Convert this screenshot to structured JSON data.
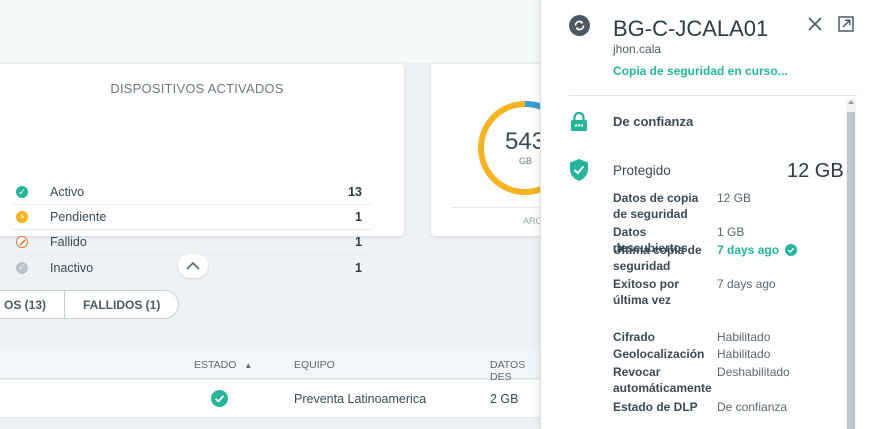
{
  "devices_card": {
    "title": "DISPOSITIVOS ACTIVADOS",
    "rows": [
      {
        "label": "Activo",
        "count": "13",
        "color": "#26b49a",
        "icon": "check-circle-icon"
      },
      {
        "label": "Pendiente",
        "count": "1",
        "color": "#f3b322",
        "icon": "clock-icon"
      },
      {
        "label": "Fallido",
        "count": "1",
        "color": "#e0773a",
        "icon": "prohibited-icon"
      },
      {
        "label": "Inactivo",
        "count": "1",
        "color": "#b8c1c7",
        "icon": "check-circle-icon"
      }
    ]
  },
  "storage_card": {
    "value": "543",
    "unit": "GB",
    "footer_label": "ARC",
    "ring_colors": {
      "main": "#f3b322",
      "accent": "#3aa0d8"
    }
  },
  "filters": {
    "tabs": [
      {
        "label": "OS (13)"
      },
      {
        "label": "FALLIDOS (1)"
      }
    ]
  },
  "table": {
    "headers": {
      "estado": "ESTADO",
      "sort_indicator": "▲",
      "equipo": "EQUIPO",
      "datos": "DATOS DES"
    },
    "rows": [
      {
        "status_icon": "check-circle-icon",
        "equipo": "Preventa Latinoamerica",
        "datos": "2 GB"
      }
    ]
  },
  "panel": {
    "title": "BG-C-JCALA01",
    "user": "jhon.cala",
    "status": "Copia de seguridad en curso...",
    "trust_label": "De confianza",
    "protect_label": "Protegido",
    "protect_size": "12 GB",
    "details": [
      {
        "key": "Datos de copia de seguridad",
        "value": "12 GB"
      },
      {
        "key": "Datos descubiertos",
        "value": "1 GB"
      },
      {
        "key": "Última copia de seguridad",
        "value": "7 days ago"
      },
      {
        "key": "Exitoso por última vez",
        "value": "7 days ago"
      }
    ],
    "settings": [
      {
        "key": "Cifrado",
        "value": "Habilitado"
      },
      {
        "key": "Geolocalización",
        "value": "Habilitado"
      },
      {
        "key": "Revocar automáticamente",
        "value": "Deshabilitado"
      },
      {
        "key": "Estado de DLP",
        "value": "De confianza"
      }
    ],
    "accent_color": "#26b49a"
  }
}
